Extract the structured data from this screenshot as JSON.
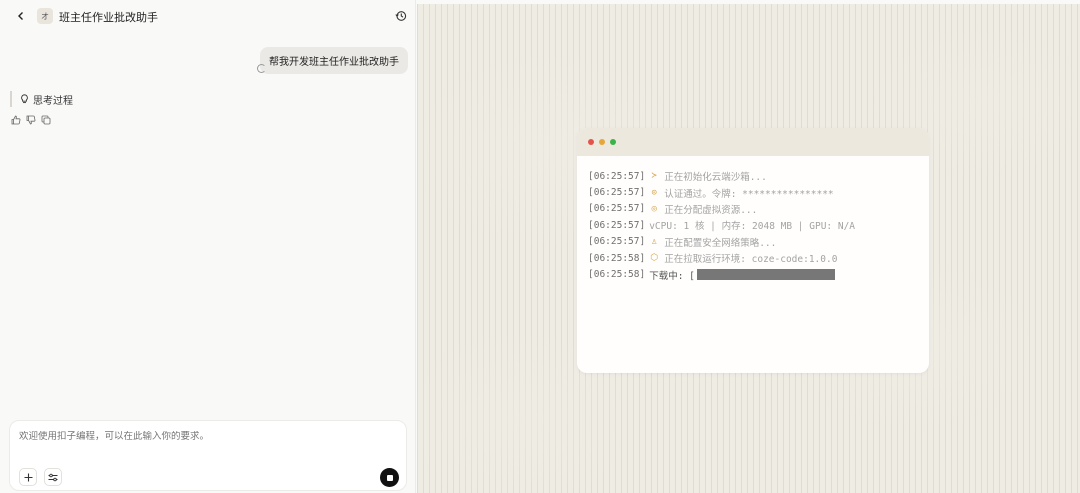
{
  "header": {
    "title": "班主任作业批改助手",
    "avatar_text": "オ"
  },
  "chat": {
    "user_message": "帮我开发班主任作业批改助手",
    "thinking_label": "思考过程"
  },
  "input": {
    "placeholder": "欢迎使用扣子编程，可以在此输入你的要求。"
  },
  "terminal": {
    "dot_colors": [
      "#e5524a",
      "#e7a63a",
      "#3ab34a"
    ],
    "lines": [
      {
        "time": "[06:25:57]",
        "icon": "prompt-icon",
        "glyph": "≻",
        "color": "#d7a24a",
        "text": "正在初始化云端沙箱..."
      },
      {
        "time": "[06:25:57]",
        "icon": "key-icon",
        "glyph": "⊙",
        "color": "#d7a24a",
        "text": "认证通过。令牌: ****************"
      },
      {
        "time": "[06:25:57]",
        "icon": "cpu-icon",
        "glyph": "◎",
        "color": "#d7a24a",
        "text": "正在分配虚拟资源..."
      },
      {
        "time": "[06:25:57]",
        "icon": "",
        "glyph": "",
        "color": "",
        "text": "vCPU: 1 核 | 内存: 2048 MB | GPU: N/A"
      },
      {
        "time": "[06:25:57]",
        "icon": "network-icon",
        "glyph": "♙",
        "color": "#d7a24a",
        "text": "正在配置安全网络策略..."
      },
      {
        "time": "[06:25:58]",
        "icon": "package-icon",
        "glyph": "⬡",
        "color": "#d7a24a",
        "text": "正在拉取运行环境: coze-code:1.0.0"
      }
    ],
    "download": {
      "time": "[06:25:58]",
      "label": "下载中: [",
      "progress": 1.0
    }
  }
}
